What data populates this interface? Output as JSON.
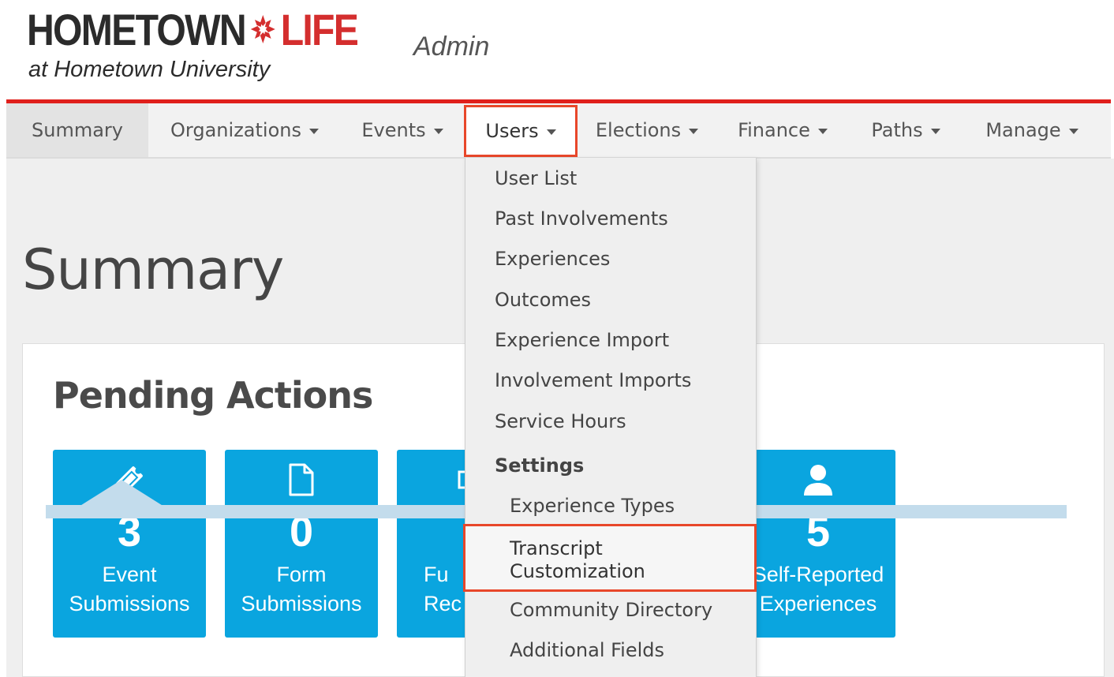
{
  "header": {
    "logo_word1": "HOMETOWN",
    "logo_word2": "LIFE",
    "logo_sub": "at Hometown University",
    "admin_label": "Admin"
  },
  "nav": {
    "items": [
      {
        "label": "Summary"
      },
      {
        "label": "Organizations"
      },
      {
        "label": "Events"
      },
      {
        "label": "Users"
      },
      {
        "label": "Elections"
      },
      {
        "label": "Finance"
      },
      {
        "label": "Paths"
      },
      {
        "label": "Manage"
      }
    ]
  },
  "page": {
    "title": "Summary",
    "panel_title": "Pending Actions"
  },
  "tiles": [
    {
      "count": "3",
      "label_line1": "Event",
      "label_line2": "Submissions",
      "icon": "ticket-icon"
    },
    {
      "count": "0",
      "label_line1": "Form",
      "label_line2": "Submissions",
      "icon": "document-icon"
    },
    {
      "count": "",
      "label_line1": "Fu",
      "label_line2": "Rec",
      "icon": "money-icon"
    },
    {
      "count": "5",
      "label_line1": "Self-Reported",
      "label_line2": "Experiences",
      "icon": "user-icon"
    }
  ],
  "dropdown": {
    "items": [
      {
        "label": "User List"
      },
      {
        "label": "Past Involvements"
      },
      {
        "label": "Experiences"
      },
      {
        "label": "Outcomes"
      },
      {
        "label": "Experience Import"
      },
      {
        "label": "Involvement Imports"
      },
      {
        "label": "Service Hours"
      }
    ],
    "settings_header": "Settings",
    "settings_items": [
      {
        "label": "Experience Types"
      },
      {
        "label": "Transcript Customization",
        "line1": "Transcript",
        "line2": "Customization"
      },
      {
        "label": "Community Directory"
      },
      {
        "label": "Additional Fields"
      }
    ]
  },
  "colors": {
    "brand_red": "#e0201c",
    "highlight_orange": "#e8472a",
    "tile_blue": "#0aa5df"
  }
}
